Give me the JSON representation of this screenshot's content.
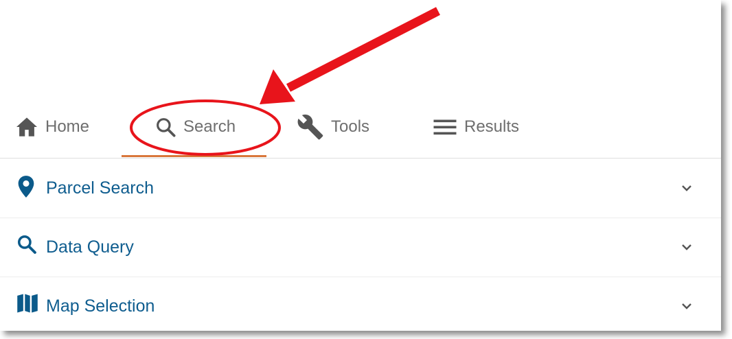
{
  "tabs": [
    {
      "label": "Home",
      "icon": "home-icon"
    },
    {
      "label": "Search",
      "icon": "search-icon",
      "active": true
    },
    {
      "label": "Tools",
      "icon": "wrench-icon"
    },
    {
      "label": "Results",
      "icon": "menu-icon"
    }
  ],
  "panels": [
    {
      "label": "Parcel Search",
      "icon": "map-pin-icon"
    },
    {
      "label": "Data Query",
      "icon": "search-icon"
    },
    {
      "label": "Map Selection",
      "icon": "map-icon"
    }
  ],
  "colors": {
    "active_underline": "#d9773b",
    "panel_text": "#0f5d8f",
    "tab_text": "#6e6e6e",
    "annotation": "#e8141b"
  }
}
